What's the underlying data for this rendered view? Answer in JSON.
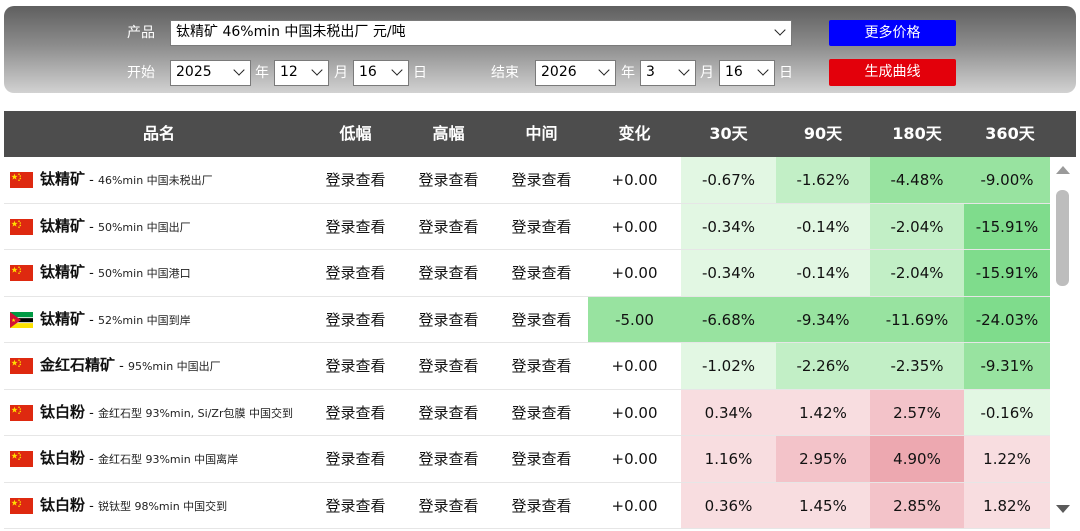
{
  "form": {
    "product_label": "产品",
    "product_value": "钛精矿  46%min 中国未税出厂 元/吨",
    "start_label": "开始",
    "start_year": "2025",
    "start_month": "12",
    "start_day": "16",
    "end_label": "结束",
    "end_year": "2026",
    "end_month": "3",
    "end_day": "16",
    "year_unit": "年",
    "month_unit": "月",
    "day_unit": "日",
    "more_prices_button": "更多价格",
    "generate_curve_button": "生成曲线",
    "more_prices_color": "#0000ff",
    "generate_curve_color": "#e3000b"
  },
  "table": {
    "headers": [
      "品名",
      "低幅",
      "高幅",
      "中间",
      "变化",
      "30天",
      "90天",
      "180天",
      "360天"
    ],
    "rows": [
      {
        "flag": "china",
        "name": "钛精矿",
        "desc": "46%min 中国未税出厂",
        "low": "登录查看",
        "high": "登录查看",
        "mid": "登录查看",
        "change": "+0.00",
        "d30": "-0.67%",
        "d90": "-1.62%",
        "d180": "-4.48%",
        "d360": "-9.00%"
      },
      {
        "flag": "china",
        "name": "钛精矿",
        "desc": "50%min 中国出厂",
        "low": "登录查看",
        "high": "登录查看",
        "mid": "登录查看",
        "change": "+0.00",
        "d30": "-0.34%",
        "d90": "-0.14%",
        "d180": "-2.04%",
        "d360": "-15.91%"
      },
      {
        "flag": "china",
        "name": "钛精矿",
        "desc": "50%min 中国港口",
        "low": "登录查看",
        "high": "登录查看",
        "mid": "登录查看",
        "change": "+0.00",
        "d30": "-0.34%",
        "d90": "-0.14%",
        "d180": "-2.04%",
        "d360": "-15.91%"
      },
      {
        "flag": "mozambique",
        "name": "钛精矿",
        "desc": "52%min 中国到岸",
        "low": "登录查看",
        "high": "登录查看",
        "mid": "登录查看",
        "change": "-5.00",
        "d30": "-6.68%",
        "d90": "-9.34%",
        "d180": "-11.69%",
        "d360": "-24.03%"
      },
      {
        "flag": "china",
        "name": "金红石精矿",
        "desc": "95%min 中国出厂",
        "low": "登录查看",
        "high": "登录查看",
        "mid": "登录查看",
        "change": "+0.00",
        "d30": "-1.02%",
        "d90": "-2.26%",
        "d180": "-2.35%",
        "d360": "-9.31%"
      },
      {
        "flag": "china",
        "name": "钛白粉",
        "desc": "金红石型 93%min, Si/Zr包膜 中国交到",
        "low": "登录查看",
        "high": "登录查看",
        "mid": "登录查看",
        "change": "+0.00",
        "d30": "0.34%",
        "d90": "1.42%",
        "d180": "2.57%",
        "d360": "-0.16%"
      },
      {
        "flag": "china",
        "name": "钛白粉",
        "desc": "金红石型 93%min 中国离岸",
        "low": "登录查看",
        "high": "登录查看",
        "mid": "登录查看",
        "change": "+0.00",
        "d30": "1.16%",
        "d90": "2.95%",
        "d180": "4.90%",
        "d360": "1.22%"
      },
      {
        "flag": "china",
        "name": "钛白粉",
        "desc": "锐钛型 98%min 中国交到",
        "low": "登录查看",
        "high": "登录查看",
        "mid": "登录查看",
        "change": "+0.00",
        "d30": "0.36%",
        "d90": "1.45%",
        "d180": "2.85%",
        "d360": "1.82%"
      }
    ]
  },
  "colors": {
    "header_bg": "#4d4d4d",
    "neg_light": "#e2f7e3",
    "neg_mid": "#c2efc6",
    "neg_strong": "#98e3a0",
    "neg_max": "#7fdc8c",
    "pos_light": "#f8dde0",
    "pos_mid": "#f3c3c9",
    "pos_strong": "#eda8b0",
    "neutral": "#ffffff"
  }
}
